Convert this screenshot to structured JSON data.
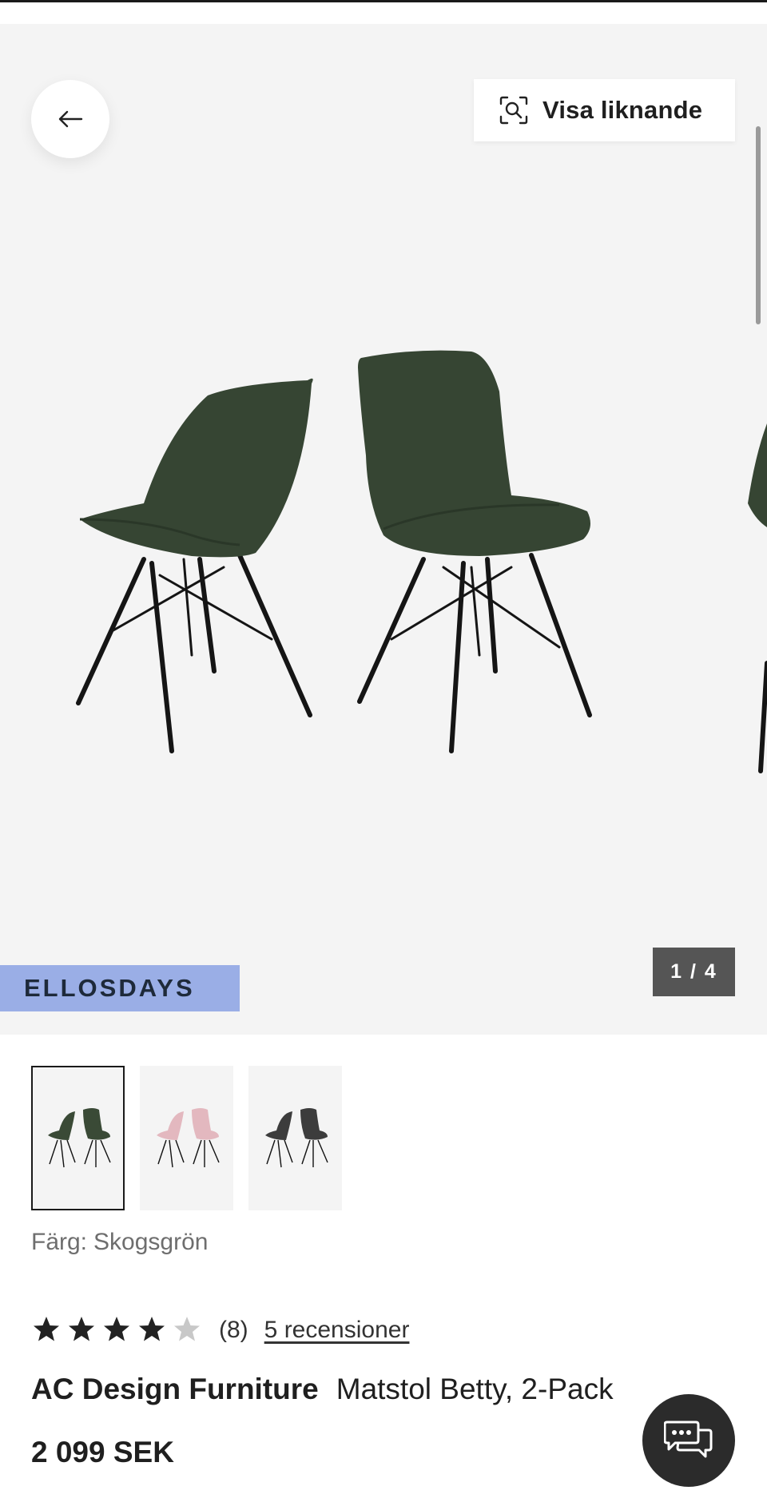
{
  "header": {
    "similar_label": "Visa liknande"
  },
  "gallery": {
    "campaign_badge": "ELLOSDAYS",
    "counter": "1 / 4",
    "current_image": 1,
    "total_images": 4
  },
  "variants": [
    {
      "name": "Skogsgrön",
      "selected": true,
      "seat_color": "#3a4a36"
    },
    {
      "name": "Rosa",
      "selected": false,
      "seat_color": "#e3b8bf"
    },
    {
      "name": "Mörkgrå",
      "selected": false,
      "seat_color": "#3c3c3c"
    }
  ],
  "color": {
    "label": "Färg:",
    "value": "Skogsgrön"
  },
  "rating": {
    "stars": 4.5,
    "count": "(8)",
    "reviews_link": "5 recensioner"
  },
  "product": {
    "brand": "AC Design Furniture",
    "name": "Matstol Betty, 2-Pack",
    "price": "2 099 SEK"
  },
  "colors": {
    "campaign": "#9aaee6",
    "counter_bg": "#555555",
    "chair_fabric": "#364533",
    "star": "#222222"
  },
  "icons": {
    "back": "arrow-left-icon",
    "similar": "visual-search-icon",
    "chat": "chat-bubbles-icon"
  }
}
